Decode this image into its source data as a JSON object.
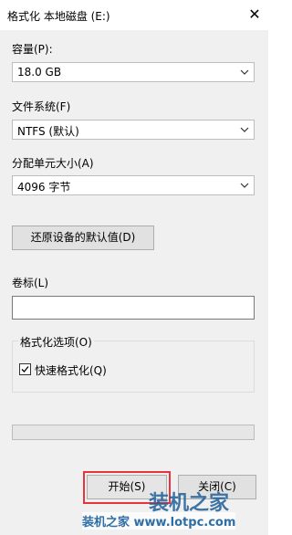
{
  "window": {
    "title": "格式化 本地磁盘 (E:)",
    "close_glyph": "✕"
  },
  "capacity": {
    "label": "容量(P):",
    "value": "18.0 GB"
  },
  "filesystem": {
    "label": "文件系统(F)",
    "value": "NTFS (默认)"
  },
  "allocation": {
    "label": "分配单元大小(A)",
    "value": "4096 字节"
  },
  "restore_defaults_label": "还原设备的默认值(D)",
  "volume_label": {
    "label": "卷标(L)",
    "value": ""
  },
  "format_options": {
    "legend": "格式化选项(O)",
    "quick_format": {
      "label": "快速格式化(Q)",
      "checked": true
    }
  },
  "progress": {
    "fraction": 0
  },
  "buttons": {
    "start": "开始(S)",
    "close": "关闭(C)"
  },
  "watermark": {
    "logo_text": "装机之家",
    "footer_text": "装机之家 www.lotpc.com"
  },
  "colors": {
    "highlight": "#e8343a",
    "progress_fill": "#06b025",
    "watermark": "#2e6ea6"
  }
}
